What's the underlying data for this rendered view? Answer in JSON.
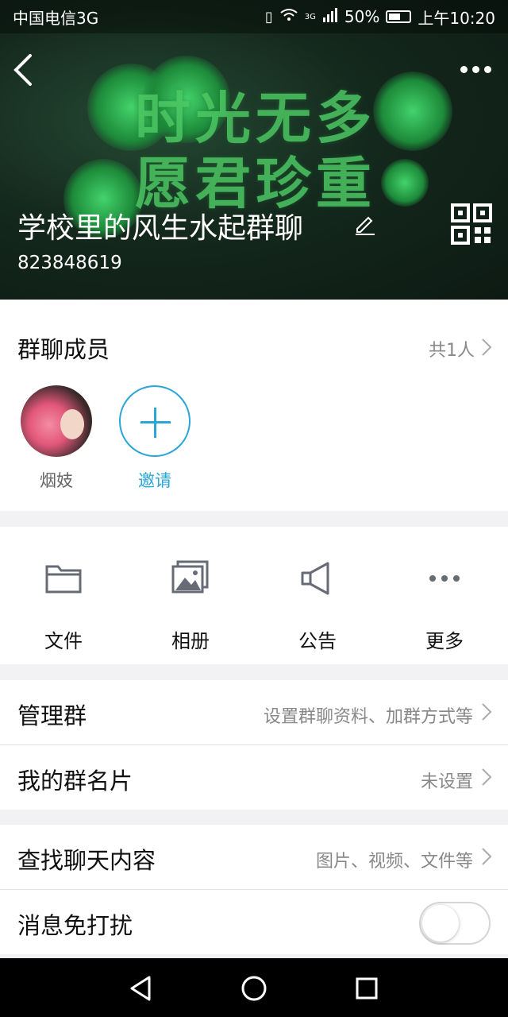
{
  "status_bar": {
    "carrier": "中国电信3G",
    "network": "3G",
    "battery": "50%",
    "time": "上午10:20"
  },
  "header": {
    "banner_line1": "时光无多",
    "banner_line2": "愿君珍重",
    "group_name": "学校里的风生水起群聊",
    "group_id": "823848619",
    "back_icon": "chevron-left-icon",
    "more_icon": "more-dots-icon",
    "edit_icon": "pencil-icon",
    "qr_icon": "qr-code-icon"
  },
  "members": {
    "title": "群聊成员",
    "count": "共1人",
    "list": [
      {
        "name": "烟妓"
      }
    ],
    "invite_label": "邀请"
  },
  "actions": [
    {
      "label": "文件",
      "icon": "folder-icon"
    },
    {
      "label": "相册",
      "icon": "photo-album-icon"
    },
    {
      "label": "公告",
      "icon": "megaphone-icon"
    },
    {
      "label": "更多",
      "icon": "more-dots-icon"
    }
  ],
  "settings": {
    "manage": {
      "label": "管理群",
      "value": "设置群聊资料、加群方式等"
    },
    "card": {
      "label": "我的群名片",
      "value": "未设置"
    },
    "search": {
      "label": "查找聊天内容",
      "value": "图片、视频、文件等"
    },
    "mute": {
      "label": "消息免打扰",
      "enabled": false
    }
  },
  "colors": {
    "accent": "#2aa6d8",
    "banner_green": "#4cc763"
  }
}
